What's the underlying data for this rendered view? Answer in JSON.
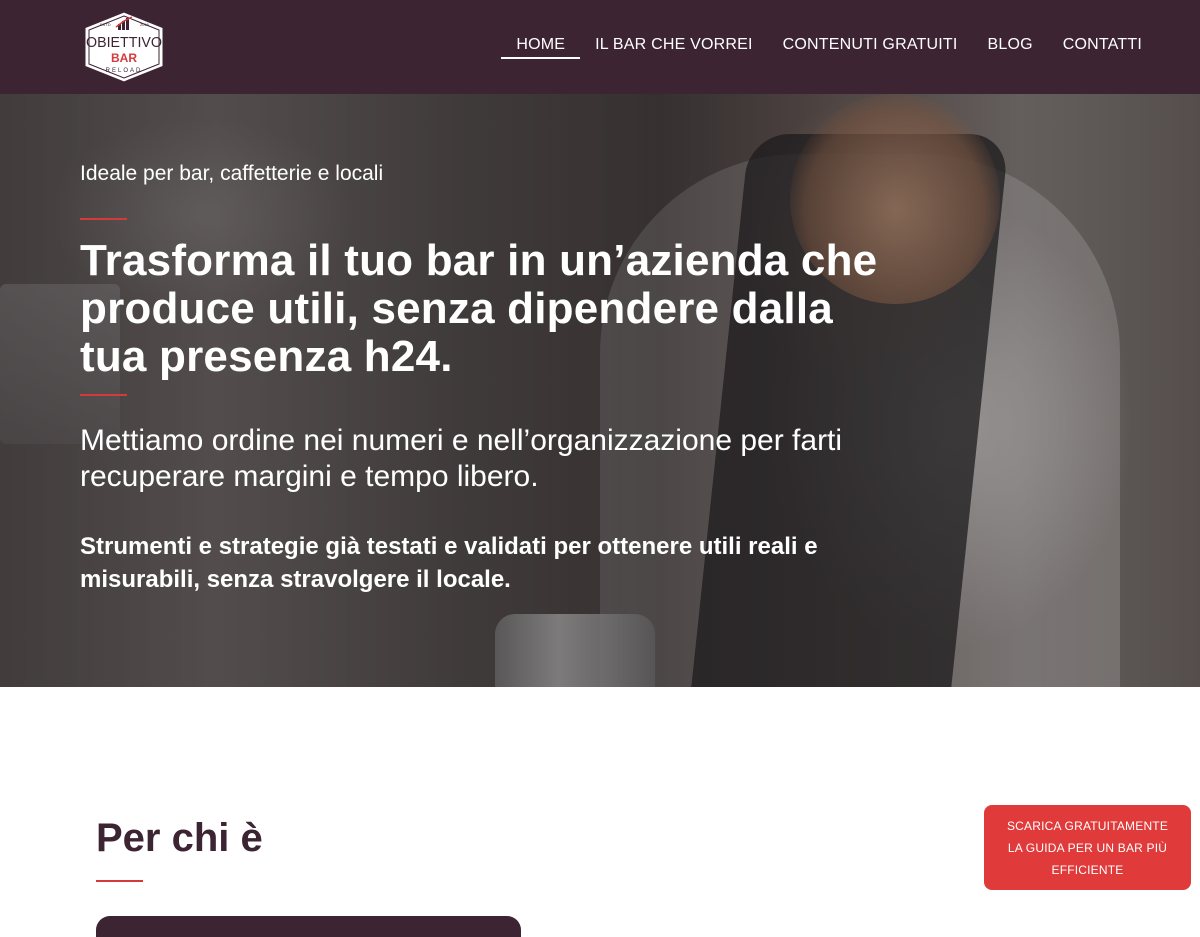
{
  "header": {
    "logo": {
      "top_text": "OBIETTIVO",
      "middle_text": "BAR",
      "bottom_text": "RELOAD",
      "est_left": "ESTD",
      "est_right": "2016"
    },
    "nav": [
      {
        "label": "HOME",
        "active": true
      },
      {
        "label": "IL BAR CHE VORREI",
        "active": false
      },
      {
        "label": "CONTENUTI GRATUITI",
        "active": false
      },
      {
        "label": "BLOG",
        "active": false
      },
      {
        "label": "CONTATTI",
        "active": false
      }
    ]
  },
  "hero": {
    "kicker": "Ideale per bar, caffetterie e locali",
    "headline": "Trasforma il tuo bar in un’azienda che produce utili, senza dipendere dalla tua presenza h24.",
    "subhead": "Mettiamo ordine nei numeri e nell’organizzazione per farti recuperare margini e tempo libero.",
    "claim": "Strumenti e strategie già testati e validati per ottenere utili reali e misurabili, senza stravolgere il locale."
  },
  "section": {
    "title": "Per chi è"
  },
  "cta": {
    "label": "SCARICA GRATUITAMENTE LA GUIDA PER UN BAR PIÙ EFFICIENTE"
  },
  "colors": {
    "header_bg": "#3d2433",
    "accent_red": "#d53a3a",
    "cta_bg": "#e03a3a",
    "text_dark": "#3d2433"
  }
}
